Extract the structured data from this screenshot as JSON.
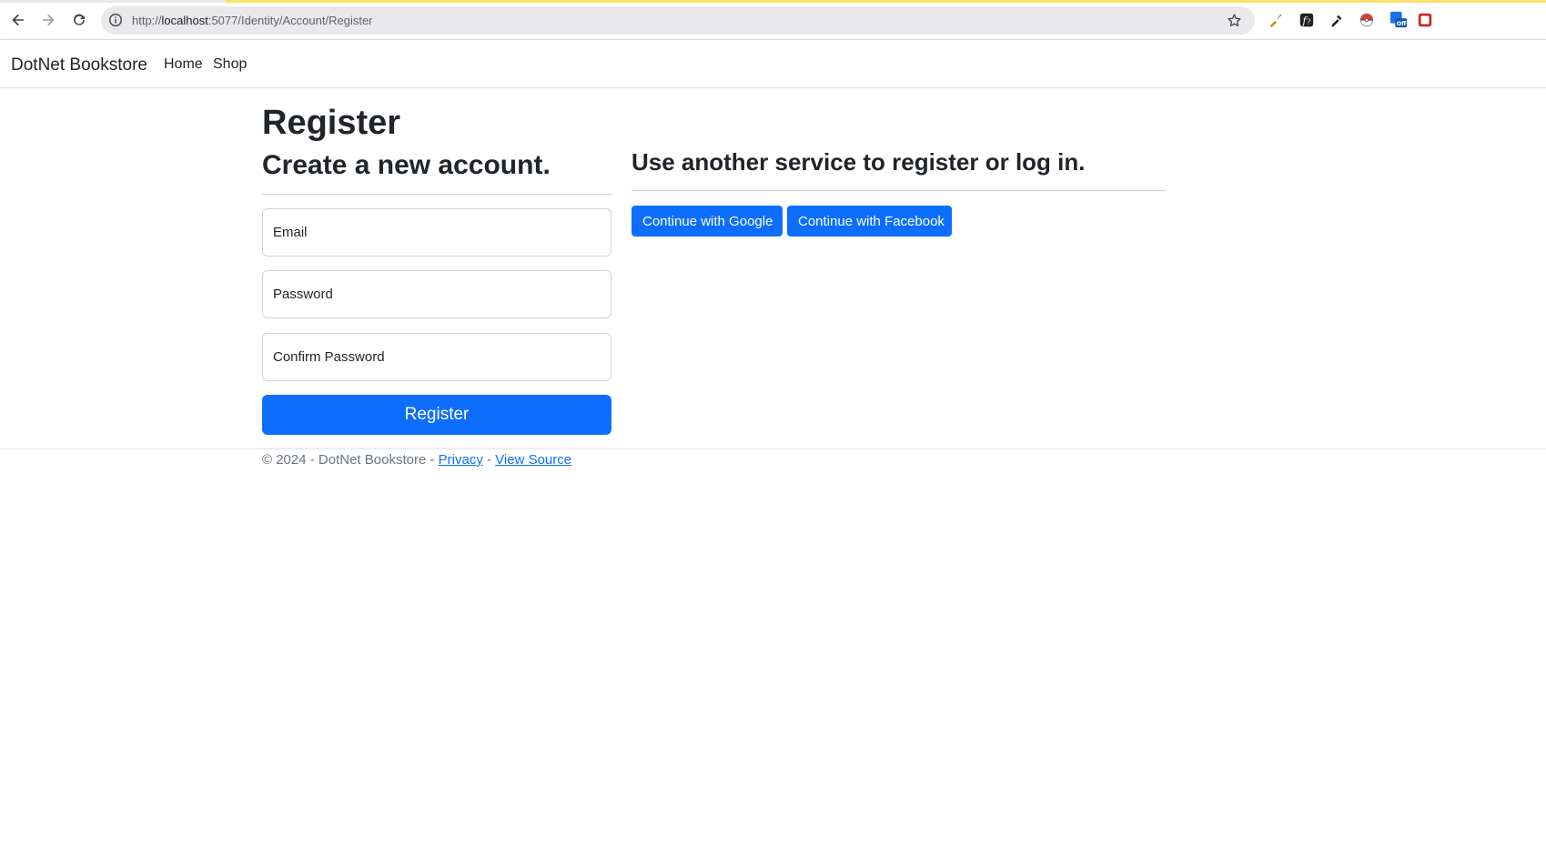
{
  "browser": {
    "url_prefix": "http://",
    "url_host": "localhost",
    "url_rest": ":5077/Identity/Account/Register"
  },
  "navbar": {
    "brand": "DotNet Bookstore",
    "links": [
      {
        "label": "Home"
      },
      {
        "label": "Shop"
      }
    ]
  },
  "main": {
    "title": "Register",
    "subtitle": "Create a new account.",
    "email_placeholder": "Email",
    "password_placeholder": "Password",
    "confirm_placeholder": "Confirm Password",
    "register_label": "Register"
  },
  "external": {
    "heading": "Use another service to register or log in.",
    "google_label": "Continue with Google",
    "facebook_label": "Continue with Facebook"
  },
  "footer": {
    "copyright": "© 2024 - DotNet Bookstore - ",
    "privacy": "Privacy",
    "separator": " - ",
    "view_source": "View Source"
  },
  "colors": {
    "primary": "#0d6efd",
    "text": "#212529",
    "muted": "#6c757d"
  }
}
